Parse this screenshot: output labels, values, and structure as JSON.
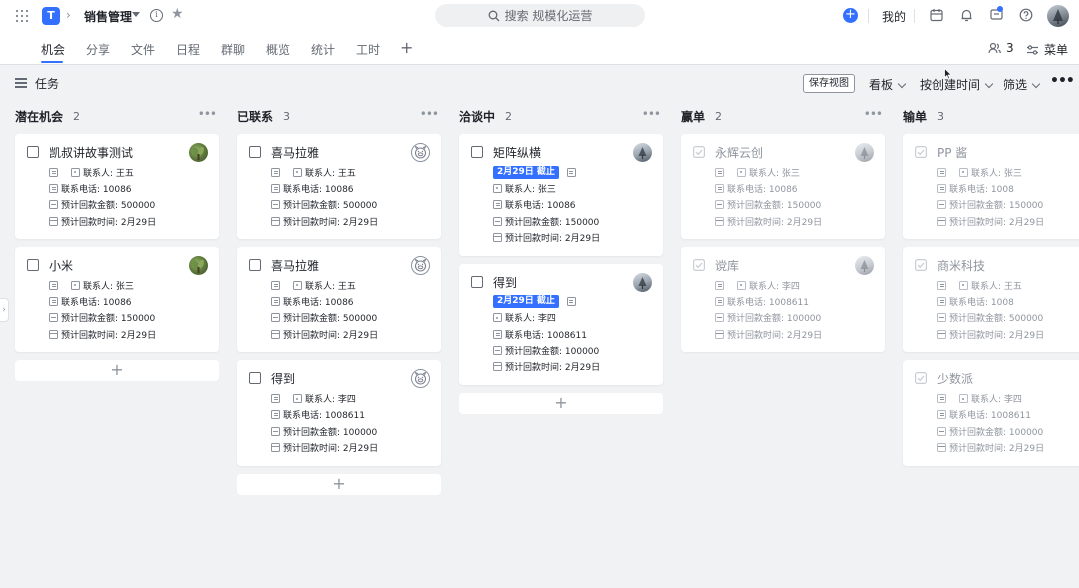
{
  "app": {
    "title": "销售管理",
    "logo_letter": "T"
  },
  "search": {
    "placeholder": "搜索 规模化运营"
  },
  "topbar": {
    "mine_label": "我的"
  },
  "tabs": [
    "机会",
    "分享",
    "文件",
    "日程",
    "群聊",
    "概览",
    "统计",
    "工时"
  ],
  "tab_right": {
    "members_count": "3",
    "menu_label": "菜单"
  },
  "toolbar": {
    "title": "任务",
    "save_view": "保存视图",
    "view_label": "看板",
    "sort_label": "按创建时间",
    "filter_label": "筛选"
  },
  "colors": {
    "accent": "#3370ff"
  },
  "columns": [
    {
      "name": "潜在机会",
      "count": "2",
      "cards": [
        {
          "title": "凯叔讲故事测试",
          "avatar": "plant-avatar",
          "fields": [
            "联系人: 王五",
            "联系电话: 10086",
            "预计回款金额: 500000",
            "预计回款时间: 2月29日"
          ]
        },
        {
          "title": "小米",
          "avatar": "plant-avatar",
          "fields": [
            "联系人: 张三",
            "联系电话: 10086",
            "预计回款金额: 150000",
            "预计回款时间: 2月29日"
          ]
        }
      ]
    },
    {
      "name": "已联系",
      "count": "3",
      "cards": [
        {
          "title": "喜马拉雅",
          "avatar": "pig-avatar",
          "fields": [
            "联系人: 王五",
            "联系电话: 10086",
            "预计回款金额: 500000",
            "预计回款时间: 2月29日"
          ]
        },
        {
          "title": "喜马拉雅",
          "avatar": "pig-avatar",
          "fields": [
            "联系人: 王五",
            "联系电话: 10086",
            "预计回款金额: 500000",
            "预计回款时间: 2月29日"
          ]
        },
        {
          "title": "得到",
          "avatar": "pig-avatar",
          "fields": [
            "联系人: 李四",
            "联系电话: 1008611",
            "预计回款金额: 100000",
            "预计回款时间: 2月29日"
          ]
        }
      ]
    },
    {
      "name": "洽谈中",
      "count": "2",
      "cards": [
        {
          "title": "矩阵纵横",
          "avatar": "tree-avatar",
          "due": "2月29日 截止",
          "fields": [
            "联系人: 张三",
            "联系电话: 10086",
            "预计回款金额: 150000",
            "预计回款时间: 2月29日"
          ]
        },
        {
          "title": "得到",
          "avatar": "tree-avatar",
          "due": "2月29日 截止",
          "fields": [
            "联系人: 李四",
            "联系电话: 1008611",
            "预计回款金额: 100000",
            "预计回款时间: 2月29日"
          ]
        }
      ]
    },
    {
      "name": "赢单",
      "count": "2",
      "cards": [
        {
          "title": "永辉云创",
          "avatar": "tree-avatar",
          "fields": [
            "联系人: 张三",
            "联系电话: 10086",
            "预计回款金额: 150000",
            "预计回款时间: 2月29日"
          ]
        },
        {
          "title": "谠库",
          "avatar": "tree-avatar",
          "fields": [
            "联系人: 李四",
            "联系电话: 1008611",
            "预计回款金额: 100000",
            "预计回款时间: 2月29日"
          ]
        }
      ]
    },
    {
      "name": "输单",
      "count": "3",
      "cards": [
        {
          "title": "PP 酱",
          "fields": [
            "联系人: 张三",
            "联系电话: 1008",
            "预计回款金额: 150000",
            "预计回款时间: 2月29日"
          ]
        },
        {
          "title": "商米科技",
          "fields": [
            "联系人: 王五",
            "联系电话: 1008",
            "预计回款金额: 500000",
            "预计回款时间: 2月29日"
          ]
        },
        {
          "title": "少数派",
          "fields": [
            "联系人: 李四",
            "联系电话: 1008611",
            "预计回款金额: 100000",
            "预计回款时间: 2月29日"
          ]
        }
      ]
    }
  ]
}
